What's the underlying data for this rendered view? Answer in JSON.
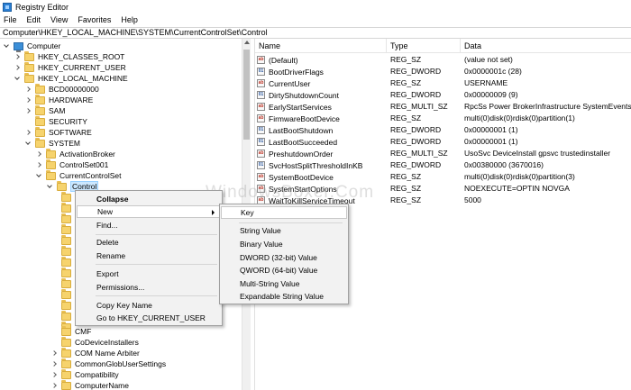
{
  "window": {
    "title": "Registry Editor"
  },
  "menubar": [
    "File",
    "Edit",
    "View",
    "Favorites",
    "Help"
  ],
  "address": "Computer\\HKEY_LOCAL_MACHINE\\SYSTEM\\CurrentControlSet\\Control",
  "tree": {
    "root": "Computer",
    "hklm": {
      "classes_root": "HKEY_CLASSES_ROOT",
      "current_user": "HKEY_CURRENT_USER",
      "local_machine": "HKEY_LOCAL_MACHINE"
    },
    "hklm_children": [
      "BCD00000000",
      "HARDWARE",
      "SAM",
      "SECURITY",
      "SOFTWARE",
      "SYSTEM"
    ],
    "system_children": [
      "ActivationBroker",
      "ControlSet001",
      "CurrentControlSet"
    ],
    "control": "Control",
    "control_children": [
      "CMF",
      "CoDeviceInstallers",
      "COM Name Arbiter",
      "CommonGlobUserSettings",
      "Compatibility",
      "ComputerName"
    ]
  },
  "list": {
    "columns": {
      "name": "Name",
      "type": "Type",
      "data": "Data"
    },
    "rows": [
      {
        "icon": "string-value-icon",
        "name": "(Default)",
        "type": "REG_SZ",
        "data": "(value not set)"
      },
      {
        "icon": "binary-value-icon",
        "name": "BootDriverFlags",
        "type": "REG_DWORD",
        "data": "0x0000001c (28)"
      },
      {
        "icon": "string-value-icon",
        "name": "CurrentUser",
        "type": "REG_SZ",
        "data": "USERNAME"
      },
      {
        "icon": "binary-value-icon",
        "name": "DirtyShutdownCount",
        "type": "REG_DWORD",
        "data": "0x00000009 (9)"
      },
      {
        "icon": "string-value-icon",
        "name": "EarlyStartServices",
        "type": "REG_MULTI_SZ",
        "data": "RpcSs Power BrokerInfrastructure SystemEventsBr..."
      },
      {
        "icon": "string-value-icon",
        "name": "FirmwareBootDevice",
        "type": "REG_SZ",
        "data": "multi(0)disk(0)rdisk(0)partition(1)"
      },
      {
        "icon": "binary-value-icon",
        "name": "LastBootShutdown",
        "type": "REG_DWORD",
        "data": "0x00000001 (1)"
      },
      {
        "icon": "binary-value-icon",
        "name": "LastBootSucceeded",
        "type": "REG_DWORD",
        "data": "0x00000001 (1)"
      },
      {
        "icon": "string-value-icon",
        "name": "PreshutdownOrder",
        "type": "REG_MULTI_SZ",
        "data": "UsoSvc DeviceInstall gpsvc trustedinstaller"
      },
      {
        "icon": "binary-value-icon",
        "name": "SvcHostSplitThresholdInKB",
        "type": "REG_DWORD",
        "data": "0x00380000 (3670016)"
      },
      {
        "icon": "string-value-icon",
        "name": "SystemBootDevice",
        "type": "REG_SZ",
        "data": "multi(0)disk(0)rdisk(0)partition(3)"
      },
      {
        "icon": "string-value-icon",
        "name": "SystemStartOptions",
        "type": "REG_SZ",
        "data": " NOEXECUTE=OPTIN  NOVGA"
      },
      {
        "icon": "string-value-icon",
        "name": "WaitToKillServiceTimeout",
        "type": "REG_SZ",
        "data": "5000"
      }
    ]
  },
  "context_menu": {
    "collapse": "Collapse",
    "new": "New",
    "find": "Find...",
    "delete": "Delete",
    "rename": "Rename",
    "export": "Export",
    "permissions": "Permissions...",
    "copy_key_name": "Copy Key Name",
    "goto": "Go to HKEY_CURRENT_USER"
  },
  "submenu": {
    "key": "Key",
    "string_value": "String Value",
    "binary_value": "Binary Value",
    "dword_value": "DWORD (32-bit) Value",
    "qword_value": "QWORD (64-bit) Value",
    "multi_string_value": "Multi-String Value",
    "expandable_string_value": "Expandable String Value"
  },
  "watermark": "WindowsBoxer.Com"
}
